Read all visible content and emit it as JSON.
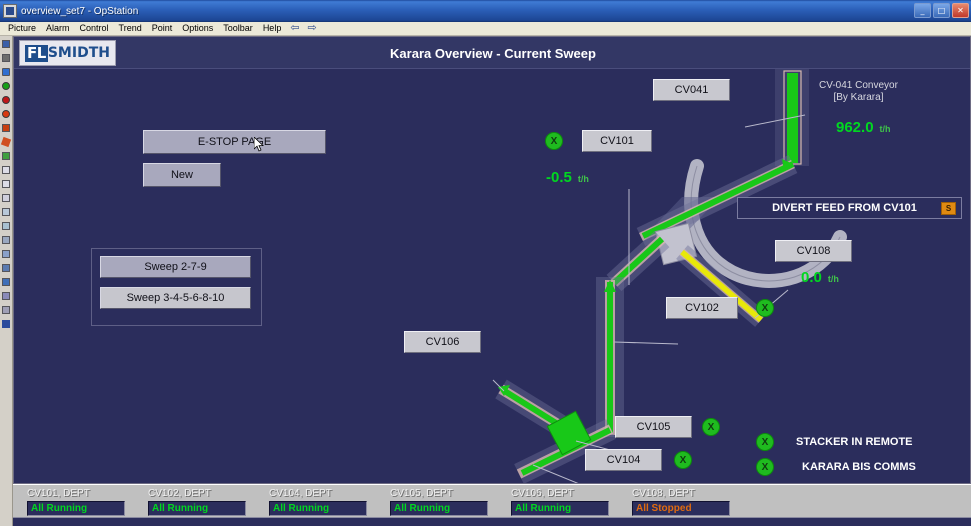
{
  "window": {
    "title": "overview_set7 - OpStation",
    "icon": "app-icon",
    "minimize": "_",
    "maximize": "□",
    "close": "✕"
  },
  "menu": {
    "items": [
      "Picture",
      "Alarm",
      "Control",
      "Trend",
      "Point",
      "Options",
      "Toolbar",
      "Help"
    ],
    "back_arrow": "⇦",
    "forward_arrow": "⇨"
  },
  "toolbar_icons": [
    "save-icon",
    "print-icon",
    "login-icon",
    "start-icon",
    "stop-icon",
    "record-icon",
    "alarm-icon",
    "ack-alarm-icon",
    "trend-icon",
    "page-icon",
    "page2-icon",
    "report-icon",
    "chart-icon",
    "graph-icon",
    "building-icon",
    "point-icon",
    "users-icon",
    "tool-icon",
    "pen-icon",
    "monitor-icon",
    "help-icon"
  ],
  "header": {
    "logo_fl": "FL",
    "logo_smidth": "SMIDTH",
    "page_title": "Karara Overview - Current Sweep"
  },
  "buttons": {
    "estop": "E-STOP PAGE",
    "new": "New",
    "sweep_a": "Sweep 2-7-9",
    "sweep_b": "Sweep 3-4-5-6-8-10"
  },
  "equipment": {
    "cv041": {
      "tag": "CV041"
    },
    "cv101": {
      "tag": "CV101",
      "value": "-0.5",
      "unit": "t/h",
      "status": "X"
    },
    "cv102": {
      "tag": "CV102",
      "status": "X"
    },
    "cv104": {
      "tag": "CV104",
      "status": "X"
    },
    "cv105": {
      "tag": "CV105",
      "status": "X"
    },
    "cv106": {
      "tag": "CV106"
    },
    "cv108": {
      "tag": "CV108",
      "value": "0.0",
      "unit": "t/h"
    }
  },
  "cv041_panel": {
    "caption_line1": "CV-041 Conveyor",
    "caption_line2": "[By Karara]",
    "value": "962.0",
    "unit": "t/h"
  },
  "divert": {
    "label": "DIVERT FEED FROM CV101",
    "badge": "S"
  },
  "indicators": [
    {
      "status": "X",
      "label": "STACKER IN REMOTE"
    },
    {
      "status": "X",
      "label": "KARARA BIS COMMS"
    }
  ],
  "status_bar": [
    {
      "name": "CV101, DEPT",
      "value": "All Running",
      "state": "running"
    },
    {
      "name": "CV102, DEPT",
      "value": "All Running",
      "state": "running"
    },
    {
      "name": "CV104, DEPT",
      "value": "All Running",
      "state": "running"
    },
    {
      "name": "CV105, DEPT",
      "value": "All Running",
      "state": "running"
    },
    {
      "name": "CV106, DEPT",
      "value": "All Running",
      "state": "running"
    },
    {
      "name": "CV108, DEPT",
      "value": "All Stopped",
      "state": "stopped"
    }
  ],
  "colors": {
    "canvas_bg": "#2b2d5c",
    "running_green": "#00d820",
    "stopped_orange": "#e06a10",
    "conveyor_green": "#18c818",
    "conveyor_yellow": "#e8e80a",
    "brand_blue": "#1f4e8c"
  }
}
